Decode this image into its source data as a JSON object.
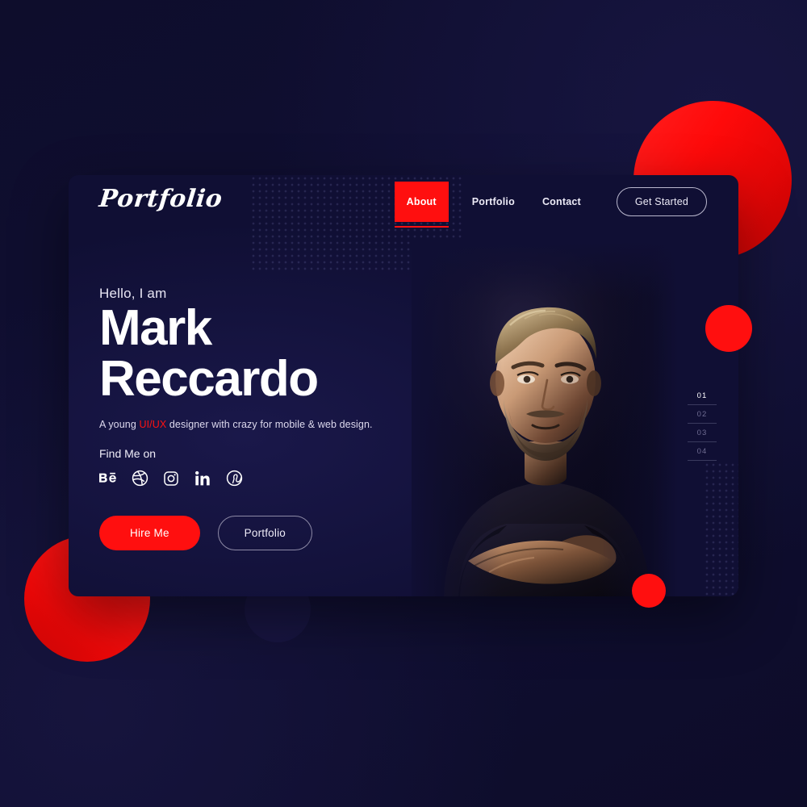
{
  "brand": {
    "logo_text": "Portfolio",
    "accent_color": "#ff0f0f",
    "card_color": "#100f34",
    "background_color": "#0f0e31"
  },
  "nav": {
    "items": [
      {
        "label": "About",
        "active": true
      },
      {
        "label": "Portfolio",
        "active": false
      },
      {
        "label": "Contact",
        "active": false
      }
    ],
    "cta_label": "Get Started"
  },
  "hero": {
    "greeting": "Hello, I am",
    "name_line1": "Mark",
    "name_line2": "Reccardo",
    "tagline_before": "A young ",
    "tagline_highlight": "UI/UX",
    "tagline_after": " designer with crazy for mobile & web design.",
    "find_me_label": "Find Me on",
    "socials": [
      {
        "name": "behance-icon",
        "label": "Behance"
      },
      {
        "name": "dribbble-icon",
        "label": "Dribbble"
      },
      {
        "name": "instagram-icon",
        "label": "Instagram"
      },
      {
        "name": "linkedin-icon",
        "label": "LinkedIn"
      },
      {
        "name": "pinterest-icon",
        "label": "Pinterest"
      }
    ],
    "primary_button": "Hire Me",
    "secondary_button": "Portfolio"
  },
  "pager": {
    "items": [
      {
        "number": "01",
        "active": true
      },
      {
        "number": "02",
        "active": false
      },
      {
        "number": "03",
        "active": false
      },
      {
        "number": "04",
        "active": false
      }
    ]
  },
  "photo": {
    "alt": "Portrait of bearded man with arms crossed in dark t-shirt"
  }
}
